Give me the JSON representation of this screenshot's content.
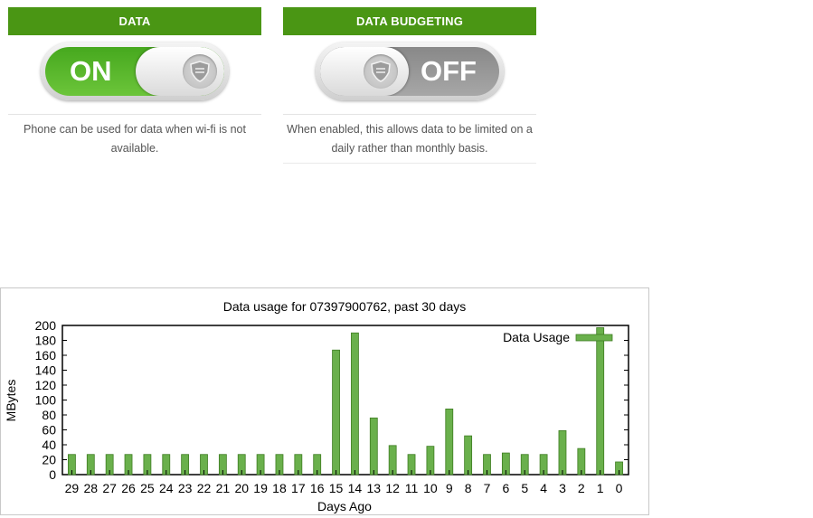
{
  "data_card": {
    "header": "DATA",
    "toggle_state": "ON",
    "description": "Phone can be used for data when wi-fi is not available."
  },
  "budget_card": {
    "header": "DATA BUDGETING",
    "toggle_state": "OFF",
    "description": "When enabled, this allows data to be limited on a daily rather than monthly basis."
  },
  "icons": {
    "toggle_knob_emblem": "shield-emblem-icon"
  },
  "colors": {
    "header_green": "#4a9614",
    "on_green": "#5bb52d",
    "off_gray": "#999999",
    "bar_green": "#6ab04c",
    "bar_outline": "#3f7d22"
  },
  "chart_data": {
    "type": "bar",
    "title": "Data usage for 07397900762, past 30 days",
    "xlabel": "Days Ago",
    "ylabel": "MBytes",
    "ylim": [
      0,
      200
    ],
    "yticks": [
      0,
      20,
      40,
      60,
      80,
      100,
      120,
      140,
      160,
      180,
      200
    ],
    "categories": [
      "29",
      "28",
      "27",
      "26",
      "25",
      "24",
      "23",
      "22",
      "21",
      "20",
      "19",
      "18",
      "17",
      "16",
      "15",
      "14",
      "13",
      "12",
      "11",
      "10",
      "9",
      "8",
      "7",
      "6",
      "5",
      "4",
      "3",
      "2",
      "1",
      "0"
    ],
    "series": [
      {
        "name": "Data Usage",
        "values": [
          27,
          27,
          27,
          27,
          27,
          27,
          27,
          27,
          27,
          27,
          27,
          27,
          27,
          27,
          167,
          190,
          76,
          39,
          27,
          38,
          88,
          52,
          27,
          29,
          27,
          27,
          59,
          35,
          197,
          17
        ]
      }
    ],
    "legend_position": "top-right",
    "grid": false
  }
}
